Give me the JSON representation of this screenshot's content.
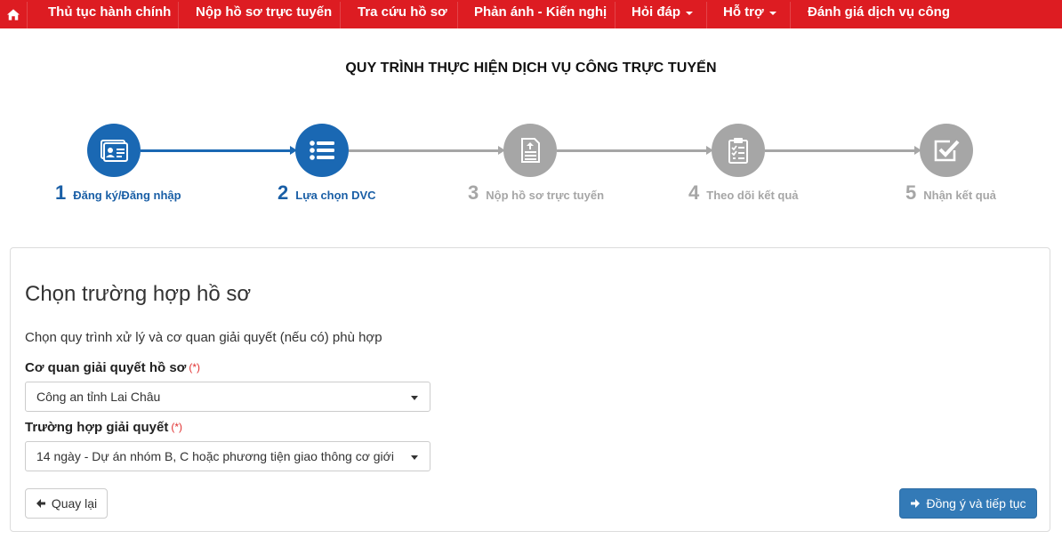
{
  "nav": {
    "items": [
      {
        "label": "Thủ tục hành chính",
        "dropdown": false
      },
      {
        "label": "Nộp hồ sơ trực tuyến",
        "dropdown": false
      },
      {
        "label": "Tra cứu hồ sơ",
        "dropdown": false
      },
      {
        "label": "Phản ánh - Kiến nghị",
        "dropdown": false
      },
      {
        "label": "Hỏi đáp",
        "dropdown": true
      },
      {
        "label": "Hỗ trợ",
        "dropdown": true
      },
      {
        "label": "Đánh giá dịch vụ công",
        "dropdown": false
      }
    ]
  },
  "process": {
    "title": "QUY TRÌNH THỰC HIỆN DỊCH VỤ CÔNG TRỰC TUYẾN",
    "steps": [
      {
        "number": "1",
        "label": "Đăng ký/Đăng nhập",
        "status": "done",
        "icon": "id-card-icon"
      },
      {
        "number": "2",
        "label": "Lựa chọn DVC",
        "status": "done",
        "icon": "list-icon"
      },
      {
        "number": "3",
        "label": "Nộp hồ sơ trực tuyến",
        "status": "todo",
        "icon": "file-upload-icon"
      },
      {
        "number": "4",
        "label": "Theo dõi kết quả",
        "status": "todo",
        "icon": "clipboard-check-icon"
      },
      {
        "number": "5",
        "label": "Nhận kết quả",
        "status": "todo",
        "icon": "checkbox-icon"
      }
    ]
  },
  "form": {
    "heading": "Chọn trường hợp hồ sơ",
    "description": "Chọn quy trình xử lý và cơ quan giải quyết (nếu có) phù hợp",
    "agency_label": "Cơ quan giải quyết hồ sơ",
    "agency_value": "Công an tỉnh Lai Châu",
    "case_label": "Trường hợp giải quyết",
    "case_value": "14 ngày - Dự án nhóm B, C hoặc phương tiện giao thông cơ giới",
    "required_mark": "(*)",
    "back_label": "Quay lại",
    "next_label": "Đồng ý và tiếp tục"
  },
  "colors": {
    "nav_bg": "#dd1c22",
    "step_done": "#1a68b3",
    "step_todo": "#a6a6a6",
    "primary_button": "#337ab7"
  }
}
